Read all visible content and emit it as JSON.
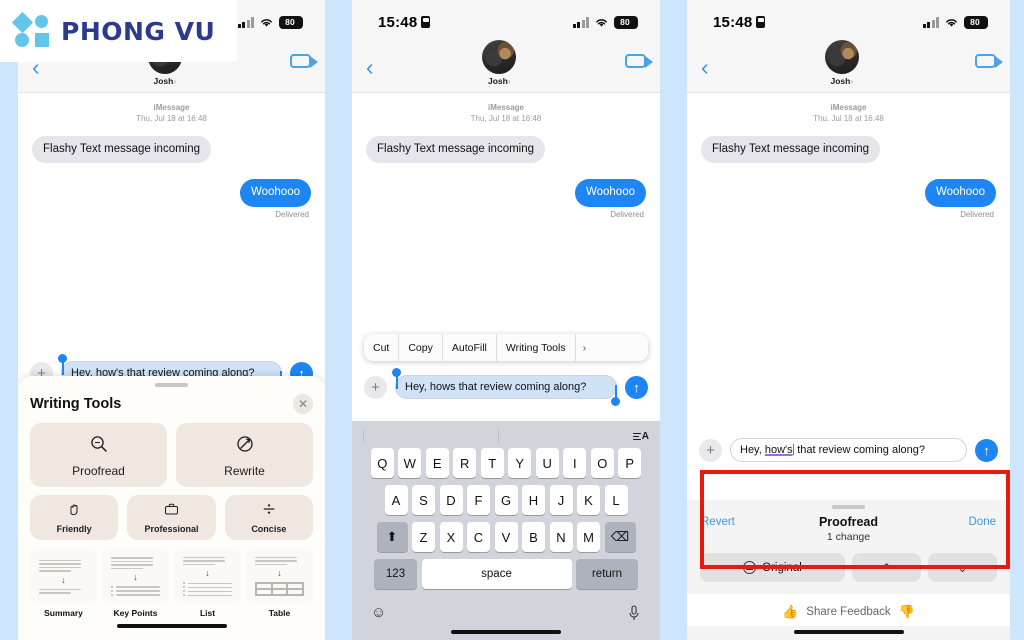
{
  "watermark": {
    "brand": "PHONG VU"
  },
  "status_bar": {
    "time": "15:48",
    "battery": "80"
  },
  "nav": {
    "contact_name": "Josh",
    "chevron": "›",
    "back_icon": "‹"
  },
  "conversation": {
    "service": "iMessage",
    "timestamp": "Thu, Jul 18 at 16:48",
    "incoming_message": "Flashy Text message incoming",
    "outgoing_message": "Woohooo",
    "delivery_status": "Delivered"
  },
  "composer": {
    "plus": "+",
    "send": "↑",
    "text_panel1": "Hey, how's that review coming along?",
    "text_panel2": "Hey, hows that review coming along?",
    "text_panel3_before": "Hey, ",
    "text_panel3_mark": "how's",
    "text_panel3_after": " that review coming along?"
  },
  "writing_tools": {
    "title": "Writing Tools",
    "close": "✕",
    "primary": [
      {
        "label": "Proofread",
        "icon": "magnifier-icon"
      },
      {
        "label": "Rewrite",
        "icon": "rewrite-circle-icon"
      }
    ],
    "tones": [
      {
        "label": "Friendly",
        "icon": "hand-wave-icon"
      },
      {
        "label": "Professional",
        "icon": "briefcase-icon"
      },
      {
        "label": "Concise",
        "icon": "divide-icon"
      }
    ],
    "formats": [
      {
        "label": "Summary"
      },
      {
        "label": "Key Points"
      },
      {
        "label": "List"
      },
      {
        "label": "Table"
      }
    ]
  },
  "context_menu": {
    "items": [
      "Cut",
      "Copy",
      "AutoFill",
      "Writing Tools"
    ],
    "more": "›"
  },
  "keyboard": {
    "format_icon_letter": "A",
    "row1": [
      "Q",
      "W",
      "E",
      "R",
      "T",
      "Y",
      "U",
      "I",
      "O",
      "P"
    ],
    "row2": [
      "A",
      "S",
      "D",
      "F",
      "G",
      "H",
      "J",
      "K",
      "L"
    ],
    "row3": [
      "Z",
      "X",
      "C",
      "V",
      "B",
      "N",
      "M"
    ],
    "shift": "⬆",
    "backspace": "⌫",
    "numbers": "123",
    "space": "space",
    "return": "return",
    "emoji": "☺",
    "mic": "🎤"
  },
  "proofread": {
    "revert": "Revert",
    "title": "Proofread",
    "done": "Done",
    "subtitle": "1 change",
    "original_button": "Original",
    "prev": "⌃",
    "next": "⌄",
    "feedback": "Share Feedback",
    "thumb_up": "👍",
    "thumb_down": "👎"
  },
  "colors": {
    "background": "#cde6fb",
    "accent_blue": "#1d86f4",
    "link_blue": "#3b9ae1",
    "annotation_red": "#e81a0c",
    "brand_navy": "#2b3a8f",
    "brand_cyan": "#61c6e8"
  }
}
